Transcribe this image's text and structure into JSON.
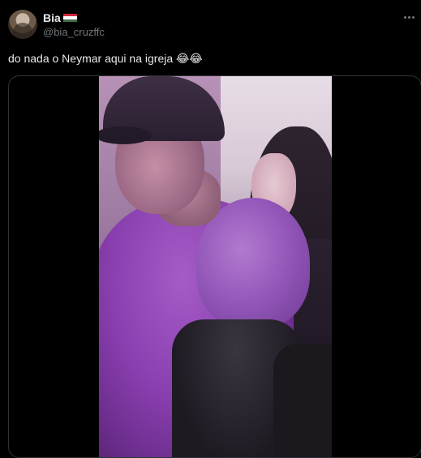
{
  "author": {
    "display_name": "Bia",
    "handle": "@bia_cruzffc",
    "flag_icon": "hungary-flag-icon"
  },
  "tweet": {
    "text": "do nada o Neymar aqui na igreja",
    "emojis": "😂😂"
  },
  "actions": {
    "more_icon": "more-options-icon"
  },
  "colors": {
    "background": "#000000",
    "text_primary": "#e7e9ea",
    "text_secondary": "#71767b",
    "media_border": "#2f3336",
    "video_tint": "#8a3fb0"
  }
}
